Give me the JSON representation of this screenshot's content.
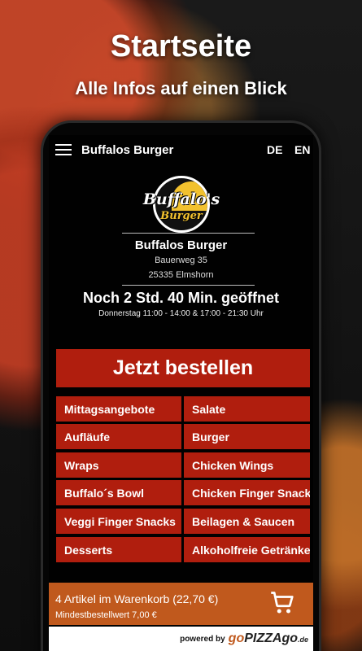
{
  "hero": {
    "title": "Startseite",
    "subtitle": "Alle Infos auf einen Blick"
  },
  "topbar": {
    "title": "Buffalos Burger",
    "lang_de": "DE",
    "lang_en": "EN",
    "menu_icon": "hamburger-menu-icon"
  },
  "logo": {
    "script_text": "Buffalo's",
    "burger_text": "Burger"
  },
  "restaurant": {
    "name": "Buffalos Burger",
    "street": "Bauerweg 35",
    "city": "25335 Elmshorn",
    "status": "Noch 2 Std. 40 Min. geöffnet",
    "hours": "Donnerstag 11:00 - 14:00 & 17:00 - 21:30 Uhr"
  },
  "order_button": "Jetzt bestellen",
  "categories": [
    "Mittagsangebote",
    "Salate",
    "Aufläufe",
    "Burger",
    "Wraps",
    "Chicken Wings",
    "Buffalo´s Bowl",
    "Chicken Finger Snacks",
    "Veggi Finger Snacks",
    "Beilagen & Saucen",
    "Desserts",
    "Alkoholfreie Getränke"
  ],
  "cart": {
    "summary": "4 Artikel im Warenkorb (22,70 €)",
    "minimum": "Mindestbestellwert 7,00 €",
    "icon": "shopping-cart-icon"
  },
  "footer": {
    "powered_by": "powered by",
    "brand_go": "go",
    "brand_pizza": "PIZZAgo",
    "brand_tld": ".de"
  },
  "colors": {
    "accent_red": "#b01e0e",
    "cart_orange": "#c0591d",
    "logo_yellow": "#f2c12e"
  }
}
